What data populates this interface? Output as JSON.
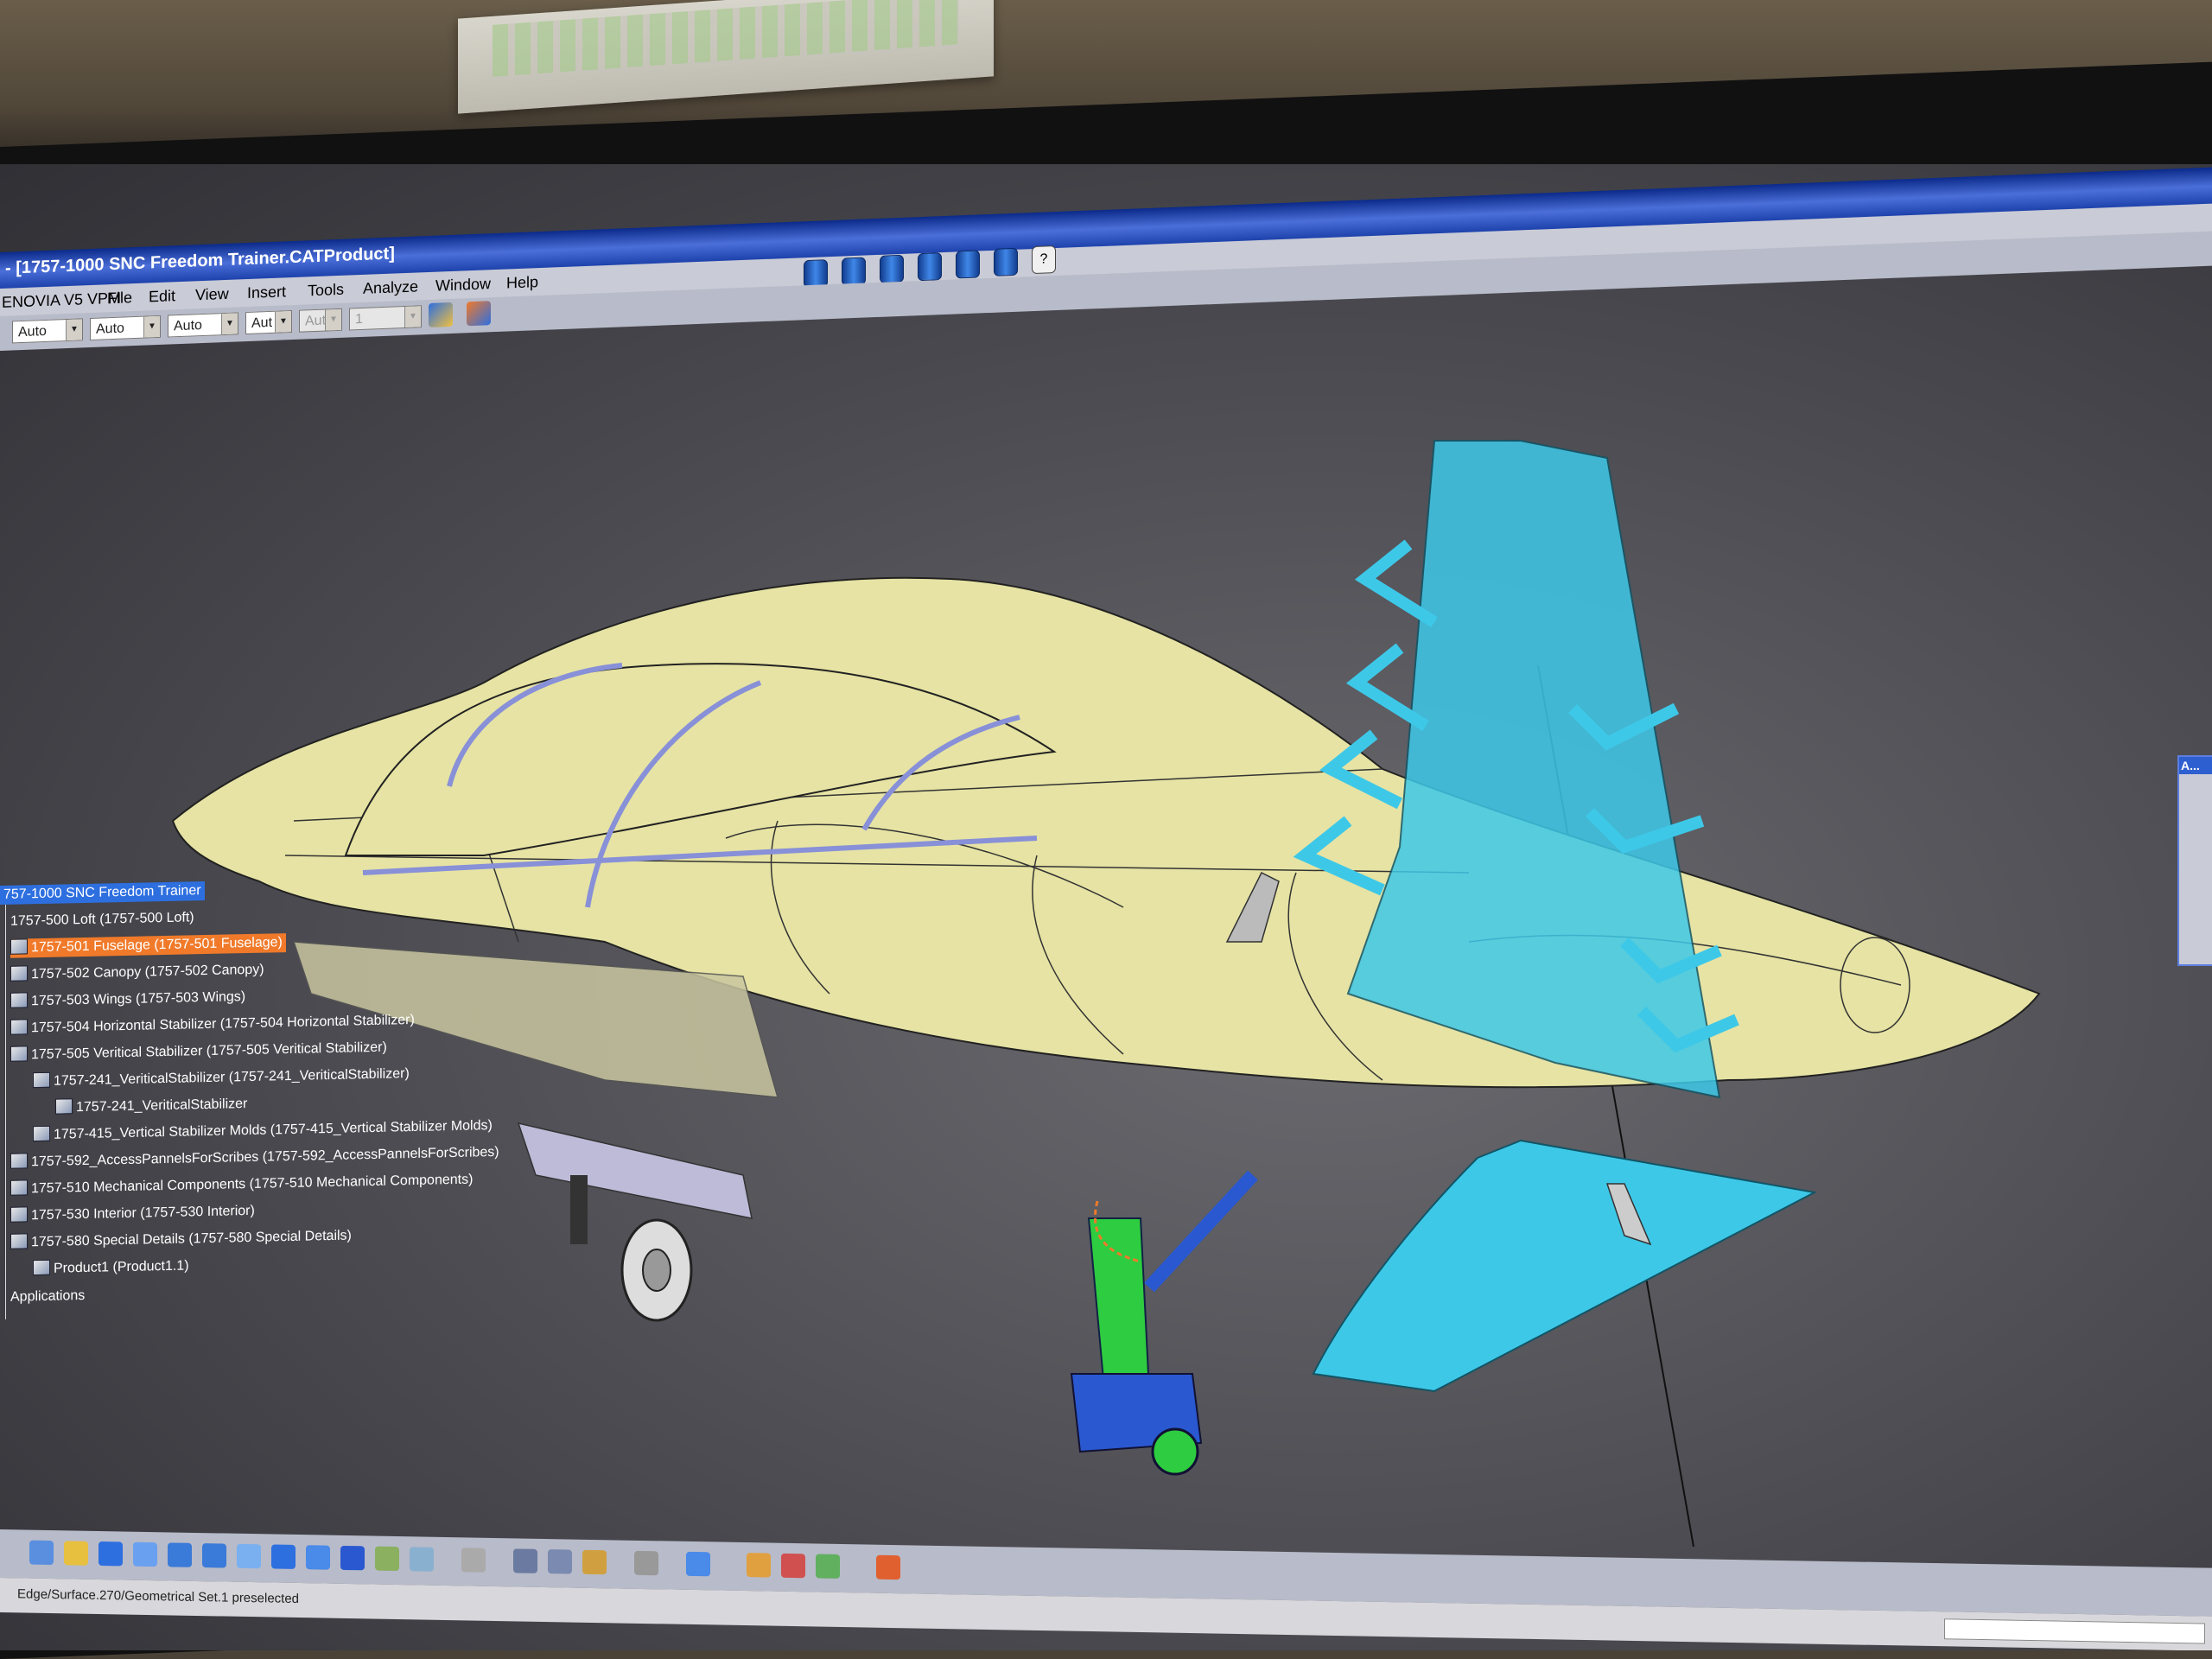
{
  "window": {
    "title": "- [1757-1000 SNC Freedom Trainer.CATProduct]"
  },
  "menubar": {
    "items": [
      "ENOVIA V5 VPM",
      "File",
      "Edit",
      "View",
      "Insert",
      "Tools",
      "Analyze",
      "Window",
      "Help"
    ]
  },
  "toolbar": {
    "combos": [
      "Auto",
      "Auto",
      "Auto",
      "Aut",
      "Aut",
      "1"
    ],
    "help_label": "?"
  },
  "spec_tree": {
    "nodes": [
      {
        "label": "757-1000 SNC Freedom Trainer",
        "level": 0,
        "state": "root"
      },
      {
        "label": "1757-500 Loft (1757-500 Loft)",
        "level": 1
      },
      {
        "label": "1757-501 Fuselage (1757-501 Fuselage)",
        "level": 1,
        "state": "selected"
      },
      {
        "label": "1757-502 Canopy (1757-502 Canopy)",
        "level": 1
      },
      {
        "label": "1757-503 Wings (1757-503 Wings)",
        "level": 1
      },
      {
        "label": "1757-504 Horizontal Stabilizer (1757-504 Horizontal Stabilizer)",
        "level": 1
      },
      {
        "label": "1757-505 Veritical Stabilizer (1757-505 Veritical Stabilizer)",
        "level": 1
      },
      {
        "label": "1757-241_VeriticalStabilizer (1757-241_VeriticalStabilizer)",
        "level": 2
      },
      {
        "label": "1757-241_VeriticalStabilizer",
        "level": 3
      },
      {
        "label": "1757-415_Vertical Stabilizer Molds (1757-415_Vertical Stabilizer Molds)",
        "level": 2
      },
      {
        "label": "1757-592_AccessPannelsForScribes (1757-592_AccessPannelsForScribes)",
        "level": 1
      },
      {
        "label": "1757-510 Mechanical Components (1757-510 Mechanical Components)",
        "level": 1
      },
      {
        "label": "1757-530 Interior (1757-530 Interior)",
        "level": 1
      },
      {
        "label": "1757-580 Special Details (1757-580 Special Details)",
        "level": 1
      },
      {
        "label": "Product1 (Product1.1)",
        "level": 2
      },
      {
        "label": "Applications",
        "level": 0
      }
    ]
  },
  "side_palette": {
    "header": "A..."
  },
  "status_bar": {
    "text": "Edge/Surface.270/Geometrical Set.1 preselected"
  },
  "colors": {
    "fuselage": "#e6e3a4",
    "vertical_stabilizer": "#3ec8e8",
    "landing_gear": "#2ecc40",
    "canopy_frame": "#8890d8",
    "selection": "#f07a2a",
    "tree_root": "#2e6fe0"
  },
  "icons": {
    "toolbar_top": [
      "cylinder-icon",
      "cylinder-icon",
      "cylinder-icon",
      "cylinder-icon",
      "cylinder-icon",
      "cylinder-icon",
      "help-icon"
    ],
    "toolbar_bottom": [
      "fly-icon",
      "fit-all-icon",
      "pan-icon",
      "rotate-icon",
      "zoom-in-icon",
      "zoom-out-icon",
      "normal-view-icon",
      "multi-view-icon",
      "iso-view-icon",
      "shading-icon",
      "hide-show-icon",
      "swap-visible-icon",
      "update-icon",
      "measure-icon",
      "catalog-icon",
      "refresh-icon",
      "plane-icon",
      "compass-icon",
      "material-icon",
      "render-icon",
      "grid-icon"
    ]
  }
}
